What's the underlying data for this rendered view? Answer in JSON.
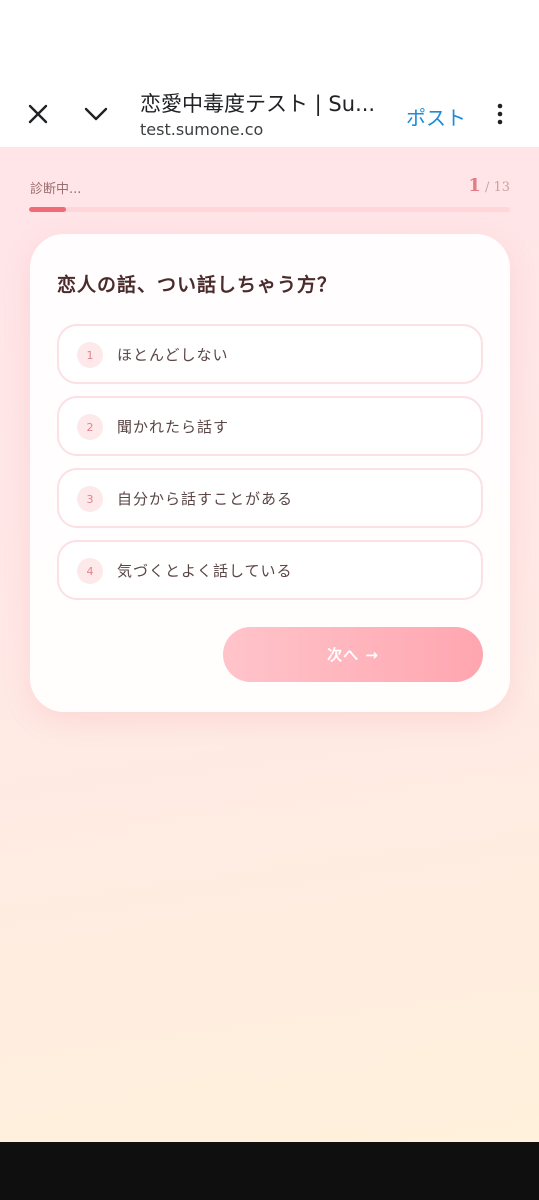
{
  "browser": {
    "tab_title": "恋愛中毒度テスト | Su...",
    "url": "test.sumone.co",
    "post_label": "ポスト"
  },
  "progress": {
    "label": "診断中...",
    "current": "1",
    "total_text": " / 13",
    "fraction": 0.077
  },
  "question": {
    "text": "恋人の話、つい話しちゃう方？",
    "options": [
      {
        "num": "1",
        "text": "ほとんどしない"
      },
      {
        "num": "2",
        "text": "聞かれたら話す"
      },
      {
        "num": "3",
        "text": "自分から話すことがある"
      },
      {
        "num": "4",
        "text": "気づくとよく話している"
      }
    ]
  },
  "next_label": "次へ →",
  "colors": {
    "accent": "#f06a78",
    "post_link": "#1a8cd8",
    "button_gradient_start": "#ffc4ca",
    "button_gradient_end": "#ffa6b0"
  },
  "icons": {
    "close": "close-icon",
    "collapse": "chevron-down-icon",
    "more": "more-vertical-icon"
  }
}
